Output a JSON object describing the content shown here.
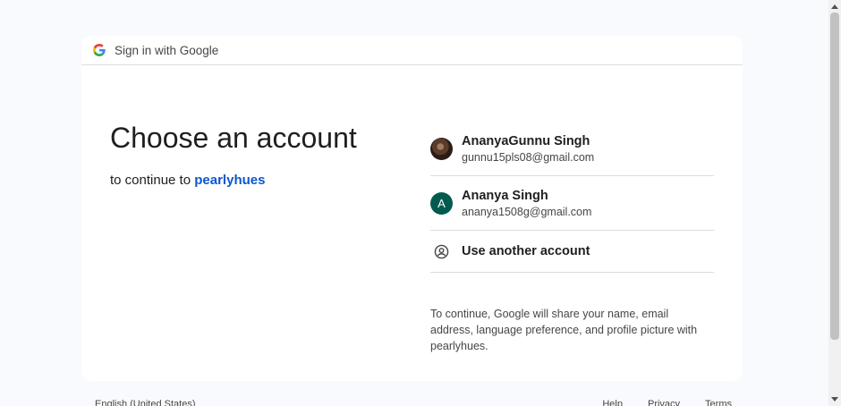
{
  "header": {
    "label": "Sign in with Google",
    "icon": "google-g-logo"
  },
  "main": {
    "heading": "Choose an account",
    "subtitle_prefix": "to continue to",
    "app_name": "pearlyhues"
  },
  "accounts": [
    {
      "name": "AnanyaGunnu Singh",
      "email": "gunnu15pls08@gmail.com",
      "avatar": "photo"
    },
    {
      "name": "Ananya Singh",
      "email": "ananya1508g@gmail.com",
      "avatar_letter": "A",
      "avatar_color": "#005b4f"
    }
  ],
  "another_account": {
    "label": "Use another account",
    "icon": "account-circle-icon"
  },
  "disclaimer": "To continue, Google will share your name, email address, language preference, and profile picture with pearlyhues.",
  "footer": {
    "language": "English (United States)",
    "links": [
      "Help",
      "Privacy",
      "Terms"
    ]
  },
  "colors": {
    "link": "#0b57d0",
    "background": "#f8fafd",
    "card": "#ffffff"
  }
}
